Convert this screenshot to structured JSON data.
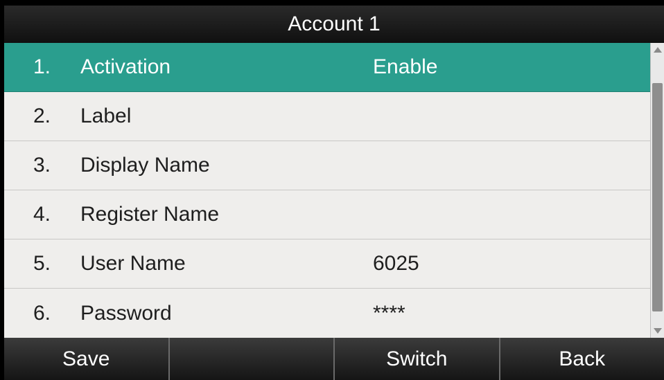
{
  "header": {
    "title": "Account 1"
  },
  "menu": {
    "items": [
      {
        "number": "1.",
        "label": "Activation",
        "value": "Enable",
        "selected": true
      },
      {
        "number": "2.",
        "label": "Label",
        "value": ""
      },
      {
        "number": "3.",
        "label": "Display Name",
        "value": ""
      },
      {
        "number": "4.",
        "label": "Register Name",
        "value": ""
      },
      {
        "number": "5.",
        "label": "User Name",
        "value": "6025"
      },
      {
        "number": "6.",
        "label": "Password",
        "value": "****"
      }
    ]
  },
  "softkeys": [
    "Save",
    "",
    "Switch",
    "Back"
  ],
  "colors": {
    "selection": "#2a9e8e",
    "list_background": "#efeeec",
    "bar_background": "#151515"
  }
}
